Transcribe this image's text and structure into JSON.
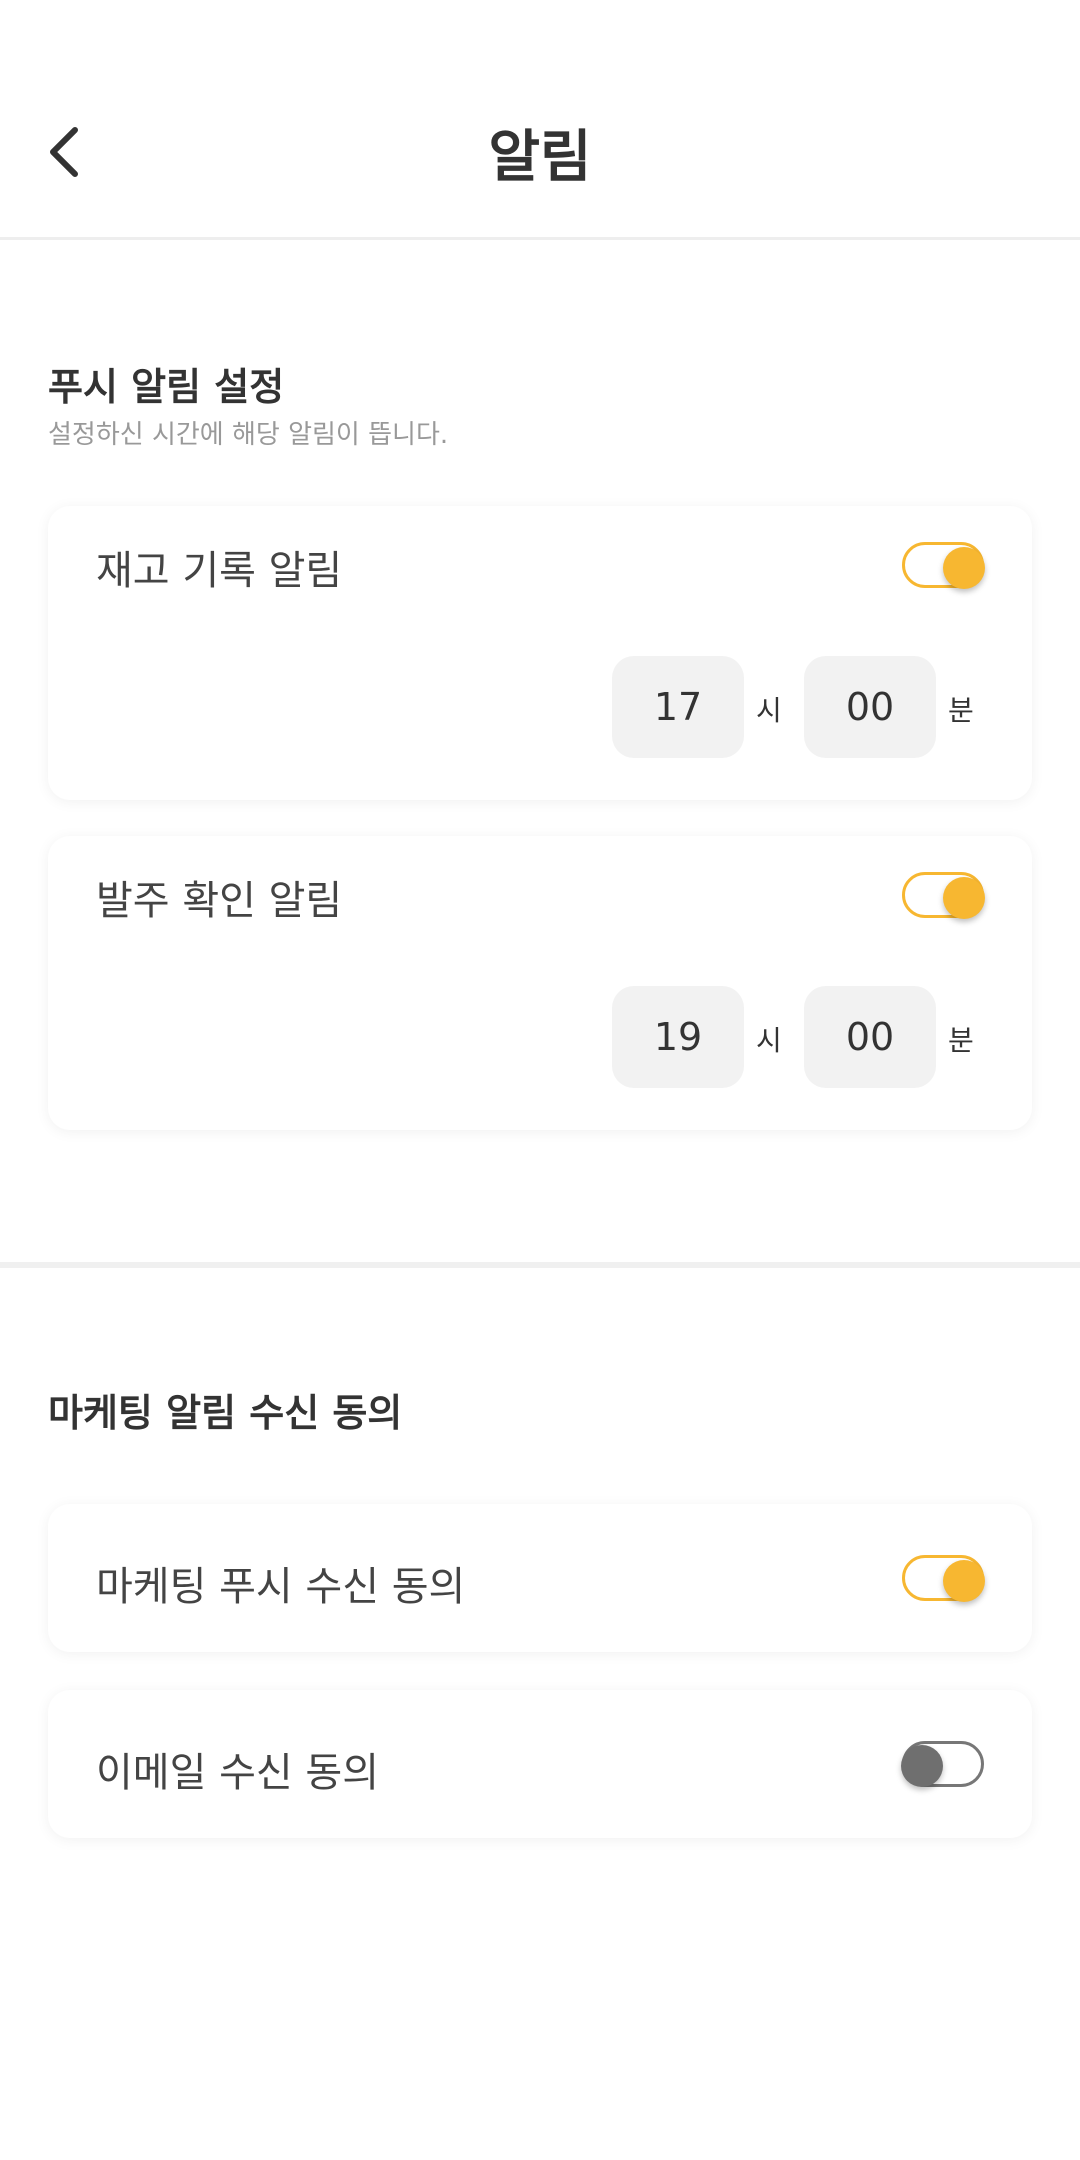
{
  "header": {
    "title": "알림",
    "back_icon": "chevron-left-icon"
  },
  "push_section": {
    "title": "푸시 알림 설정",
    "description": "설정하신 시간에 해당 알림이 뜹니다.",
    "items": [
      {
        "label": "재고 기록 알림",
        "enabled": true,
        "hour": "17",
        "hour_unit": "시",
        "minute": "00",
        "minute_unit": "분"
      },
      {
        "label": "발주 확인 알림",
        "enabled": true,
        "hour": "19",
        "hour_unit": "시",
        "minute": "00",
        "minute_unit": "분"
      }
    ]
  },
  "marketing_section": {
    "title": "마케팅 알림 수신 동의",
    "items": [
      {
        "label": "마케팅 푸시 수신 동의",
        "enabled": true
      },
      {
        "label": "이메일 수신 동의",
        "enabled": false
      }
    ]
  },
  "colors": {
    "accent": "#F7B731",
    "toggle_off": "#6F6F6F",
    "time_box_bg": "#F2F2F2"
  }
}
